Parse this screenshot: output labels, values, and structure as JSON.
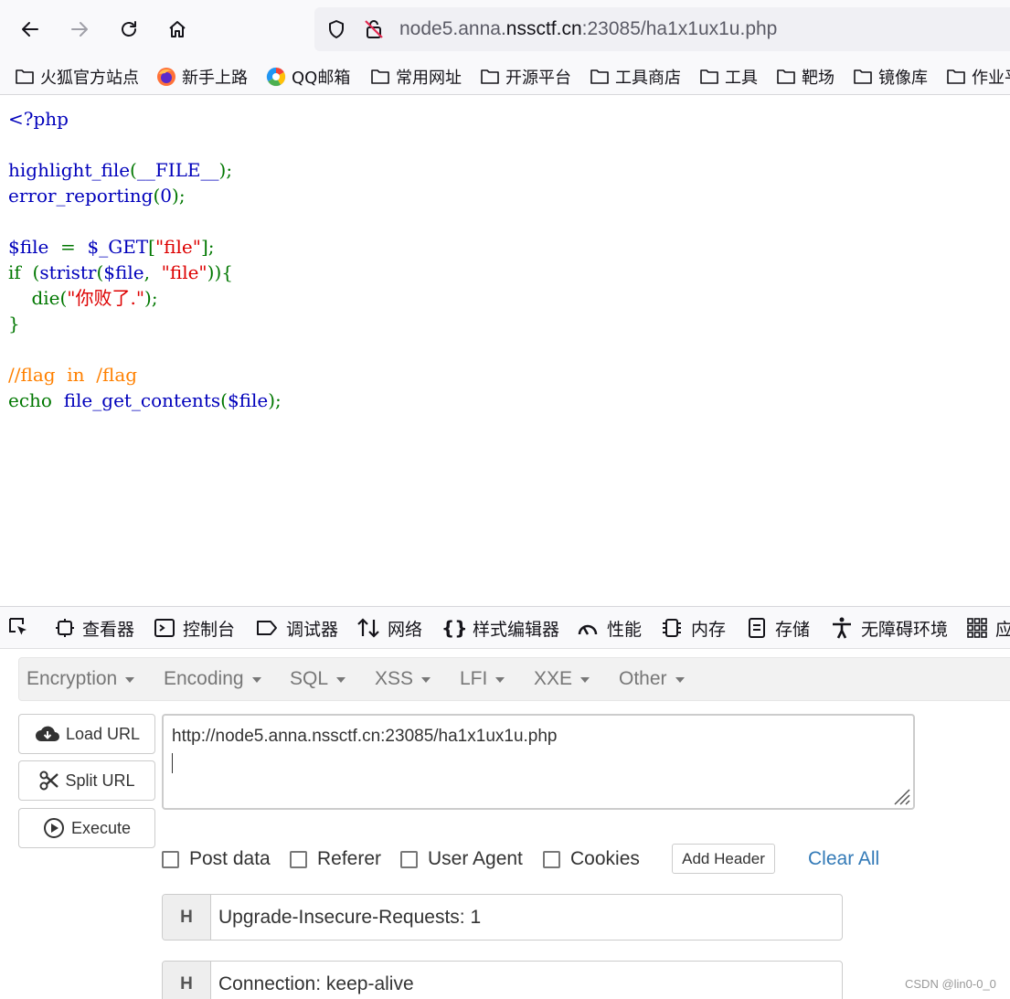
{
  "browser": {
    "url_prefix": "node5.anna.",
    "url_domain": "nssctf.cn",
    "url_suffix": ":23085/ha1x1ux1u.php"
  },
  "bookmarks": [
    {
      "label": "火狐官方站点",
      "icon": "folder-icon"
    },
    {
      "label": "新手上路",
      "icon": "firefox-icon"
    },
    {
      "label": "QQ邮箱",
      "icon": "qq-mail-icon"
    },
    {
      "label": "常用网址",
      "icon": "folder-icon"
    },
    {
      "label": "开源平台",
      "icon": "folder-icon"
    },
    {
      "label": "工具商店",
      "icon": "folder-icon"
    },
    {
      "label": "工具",
      "icon": "folder-icon"
    },
    {
      "label": "靶场",
      "icon": "folder-icon"
    },
    {
      "label": "镜像库",
      "icon": "folder-icon"
    },
    {
      "label": "作业平",
      "icon": "folder-icon"
    }
  ],
  "code": {
    "open_tag": "<?php",
    "l2_fn": "highlight_file",
    "l2_p1": "(",
    "l2_arg": "__FILE__",
    "l2_p2": ");",
    "l3_fn": "error_reporting",
    "l3_p1": "(",
    "l3_arg": "0",
    "l3_p2": ");",
    "l5_var": "$file",
    "l5_eq": "=",
    "l5_get": "$_GET",
    "l5_b1": "[",
    "l5_str": "\"file\"",
    "l5_b2": "];",
    "l6_if": "if",
    "l6_p1": "(",
    "l6_fn": "stristr",
    "l6_p2": "(",
    "l6_var": "$file",
    "l6_comma": ",",
    "l6_str": "\"file\"",
    "l6_p3": ")){",
    "l7_die": "die(",
    "l7_str": "\"你败了.\"",
    "l7_p": ");",
    "l8_brace": "}",
    "l10_comment": "//flag  in  /flag",
    "l11_echo": "echo",
    "l11_fn": "file_get_contents",
    "l11_p1": "(",
    "l11_var": "$file",
    "l11_p2": ");"
  },
  "devtools": {
    "tabs": [
      {
        "label": "查看器",
        "icon": "inspector-icon"
      },
      {
        "label": "控制台",
        "icon": "console-icon"
      },
      {
        "label": "调试器",
        "icon": "debugger-icon"
      },
      {
        "label": "网络",
        "icon": "network-icon"
      },
      {
        "label": "样式编辑器",
        "icon": "style-editor-icon"
      },
      {
        "label": "性能",
        "icon": "performance-icon"
      },
      {
        "label": "内存",
        "icon": "memory-icon"
      },
      {
        "label": "存储",
        "icon": "storage-icon"
      },
      {
        "label": "无障碍环境",
        "icon": "accessibility-icon"
      },
      {
        "label": "应",
        "icon": "grid-icon"
      }
    ]
  },
  "hackbar": {
    "menu": [
      "Encryption",
      "Encoding",
      "SQL",
      "XSS",
      "LFI",
      "XXE",
      "Other"
    ],
    "load_url": "Load URL",
    "split_url": "Split URL",
    "execute": "Execute",
    "url_value": "http://node5.anna.nssctf.cn:23085/ha1x1ux1u.php",
    "options": [
      "Post data",
      "Referer",
      "User Agent",
      "Cookies"
    ],
    "add_header": "Add Header",
    "clear_all": "Clear All",
    "headers": [
      {
        "tag": "H",
        "value": "Upgrade-Insecure-Requests: 1"
      },
      {
        "tag": "H",
        "value": "Connection: keep-alive"
      }
    ]
  },
  "watermark": "CSDN @lin0-0_0"
}
